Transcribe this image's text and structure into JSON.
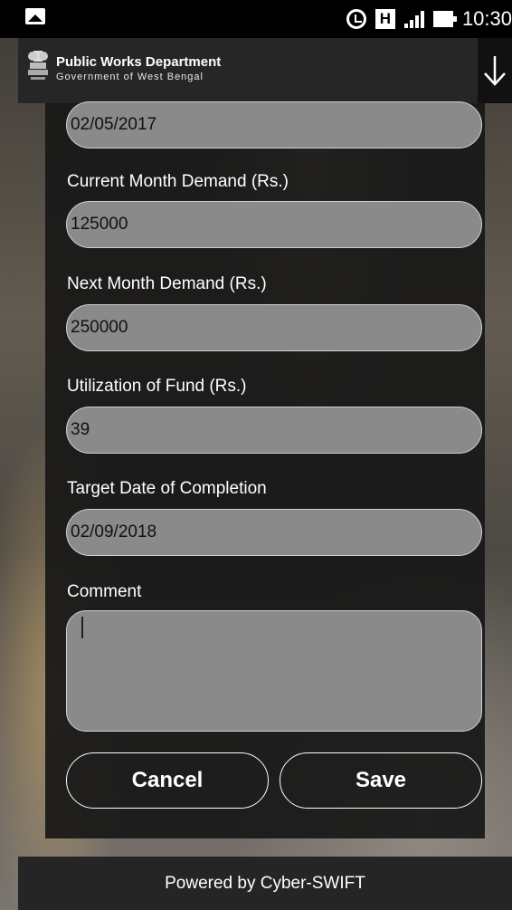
{
  "status_bar": {
    "time": "10:30",
    "icons": [
      "image-icon",
      "alarm-icon",
      "h-icon",
      "signal-icon",
      "battery-icon"
    ]
  },
  "header": {
    "title": "Public Works Department",
    "subtitle": "Government of West Bengal",
    "download_icon": "arrow-down-icon"
  },
  "form": {
    "fields": [
      {
        "label": "",
        "value": "02/05/2017"
      },
      {
        "label": "Current Month Demand (Rs.)",
        "value": "125000"
      },
      {
        "label": "Next Month Demand (Rs.)",
        "value": "250000"
      },
      {
        "label": "Utilization of Fund (Rs.)",
        "value": "39"
      },
      {
        "label": "Target Date of Completion",
        "value": "02/09/2018"
      }
    ],
    "comment_label": "Comment",
    "comment_value": "",
    "cancel_label": "Cancel",
    "save_label": "Save"
  },
  "footer": {
    "text": "Powered by Cyber-SWIFT"
  },
  "colors": {
    "panel": "#181818",
    "field": "#8a8a8a",
    "appbar": "#262626"
  }
}
